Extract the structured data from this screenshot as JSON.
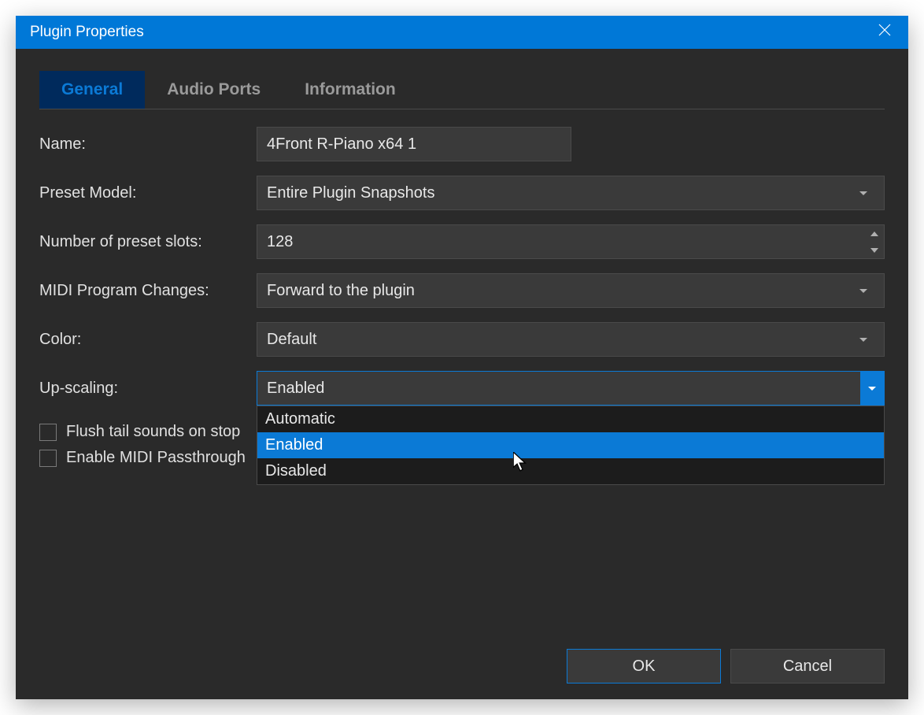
{
  "window": {
    "title": "Plugin Properties"
  },
  "tabs": {
    "general": "General",
    "audio_ports": "Audio Ports",
    "information": "Information"
  },
  "form": {
    "name_label": "Name:",
    "name_value": "4Front R-Piano x64 1",
    "preset_model_label": "Preset Model:",
    "preset_model_value": "Entire Plugin Snapshots",
    "slots_label": "Number of preset slots:",
    "slots_value": "128",
    "midi_label": "MIDI Program Changes:",
    "midi_value": "Forward to the plugin",
    "color_label": "Color:",
    "color_value": "Default",
    "upscaling_label": "Up-scaling:",
    "upscaling_value": "Enabled",
    "upscaling_options": {
      "0": "Automatic",
      "1": "Enabled",
      "2": "Disabled"
    },
    "flush_label": "Flush tail sounds on stop",
    "passthrough_label": "Enable MIDI Passthrough"
  },
  "footer": {
    "ok": "OK",
    "cancel": "Cancel"
  }
}
